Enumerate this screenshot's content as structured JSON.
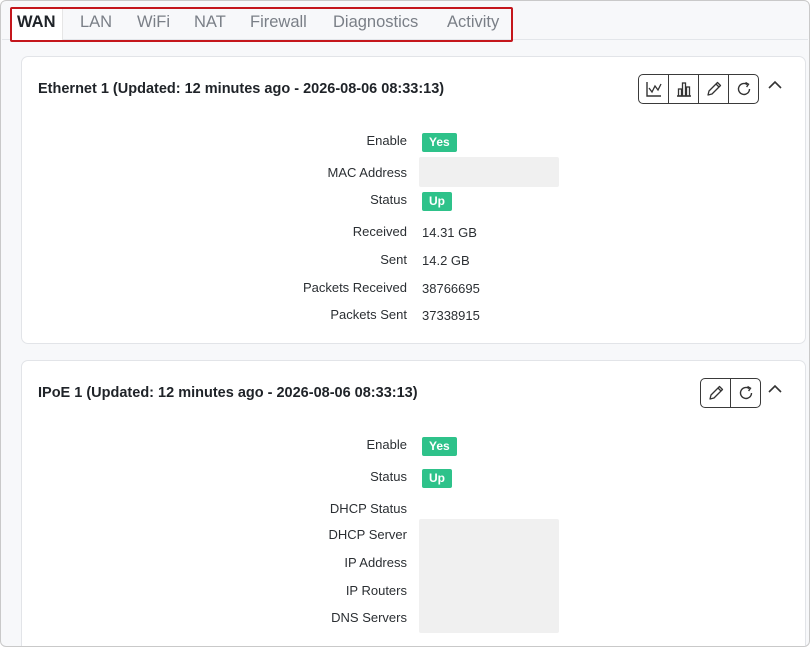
{
  "tabs": [
    {
      "label": "WAN",
      "active": true
    },
    {
      "label": "LAN",
      "active": false
    },
    {
      "label": "WiFi",
      "active": false
    },
    {
      "label": "NAT",
      "active": false
    },
    {
      "label": "Firewall",
      "active": false
    },
    {
      "label": "Diagnostics",
      "active": false
    },
    {
      "label": "Activity",
      "active": false
    }
  ],
  "cards": [
    {
      "title": "Ethernet 1 (Updated: 12 minutes ago - 2026-08-06 08:33:13)",
      "buttons": [
        "line-chart-icon",
        "bar-chart-icon",
        "pencil-icon",
        "refresh-icon"
      ],
      "rows": [
        {
          "label": "Enable",
          "type": "badge",
          "value": "Yes"
        },
        {
          "label": "MAC Address",
          "type": "redacted",
          "value": ""
        },
        {
          "label": "Status",
          "type": "badge",
          "value": "Up"
        },
        {
          "label": "Received",
          "type": "text",
          "value": "14.31 GB"
        },
        {
          "label": "Sent",
          "type": "text",
          "value": "14.2 GB"
        },
        {
          "label": "Packets Received",
          "type": "text",
          "value": "38766695"
        },
        {
          "label": "Packets Sent",
          "type": "text",
          "value": "37338915"
        }
      ]
    },
    {
      "title": "IPoE 1 (Updated: 12 minutes ago - 2026-08-06 08:33:13)",
      "buttons": [
        "pencil-icon",
        "refresh-icon"
      ],
      "rows": [
        {
          "label": "Enable",
          "type": "badge",
          "value": "Yes"
        },
        {
          "label": "Status",
          "type": "badge",
          "value": "Up"
        },
        {
          "label": "DHCP Status",
          "type": "text",
          "value": ""
        },
        {
          "label": "DHCP Server",
          "type": "redacted",
          "value": ""
        },
        {
          "label": "IP Address",
          "type": "redacted",
          "value": ""
        },
        {
          "label": "IP Routers",
          "type": "redacted",
          "value": ""
        },
        {
          "label": "DNS Servers",
          "type": "redacted",
          "value": ""
        }
      ]
    }
  ],
  "colors": {
    "badge": "#2ec28a",
    "highlight": "#c4161c"
  }
}
